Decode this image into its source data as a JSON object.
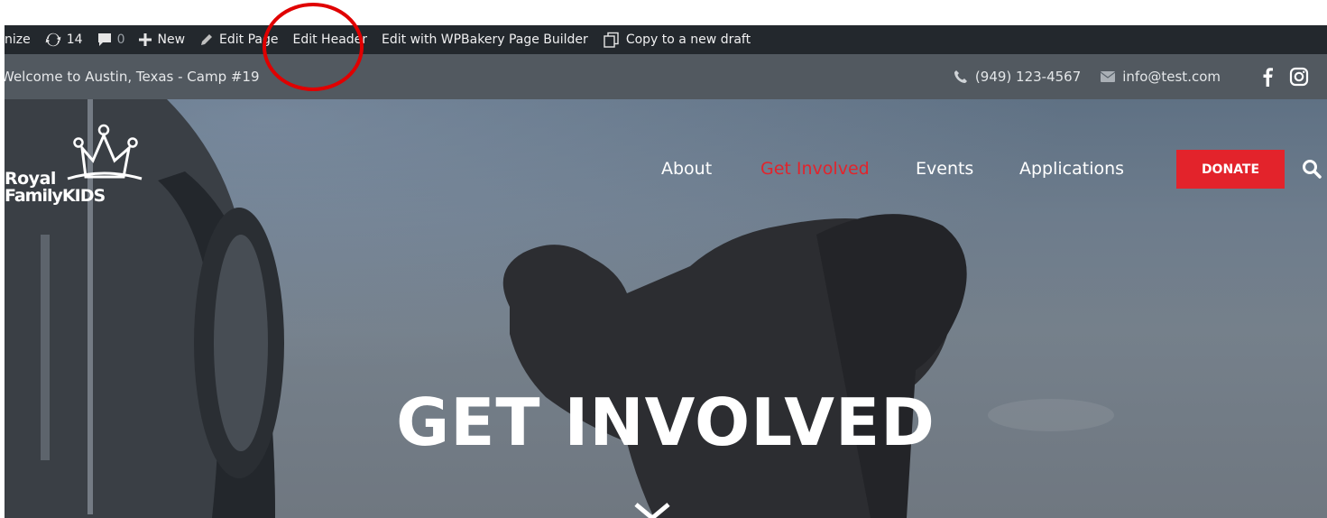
{
  "admin_bar": {
    "customize": "nize",
    "updates_count": "14",
    "comments_count": "0",
    "new_label": "New",
    "edit_page": "Edit Page",
    "edit_header": "Edit Header",
    "edit_wpbakery": "Edit with WPBakery Page Builder",
    "copy_draft": "Copy to a new draft"
  },
  "top_bar": {
    "welcome": "Welcome to Austin, Texas - Camp #19",
    "phone": "(949) 123-4567",
    "email": "info@test.com",
    "social_icons": [
      "facebook-icon",
      "instagram-icon"
    ]
  },
  "logo": {
    "line1": "Royal",
    "line2": "FamilyKIDS"
  },
  "nav": {
    "items": [
      {
        "label": "About"
      },
      {
        "label": "Get Involved"
      },
      {
        "label": "Events"
      },
      {
        "label": "Applications"
      }
    ],
    "active_index": 1,
    "donate": "DONATE"
  },
  "hero": {
    "title": "GET INVOLVED"
  },
  "colors": {
    "accent": "#e3232b",
    "admin_bar": "#23282d",
    "annotation": "#e00000"
  }
}
